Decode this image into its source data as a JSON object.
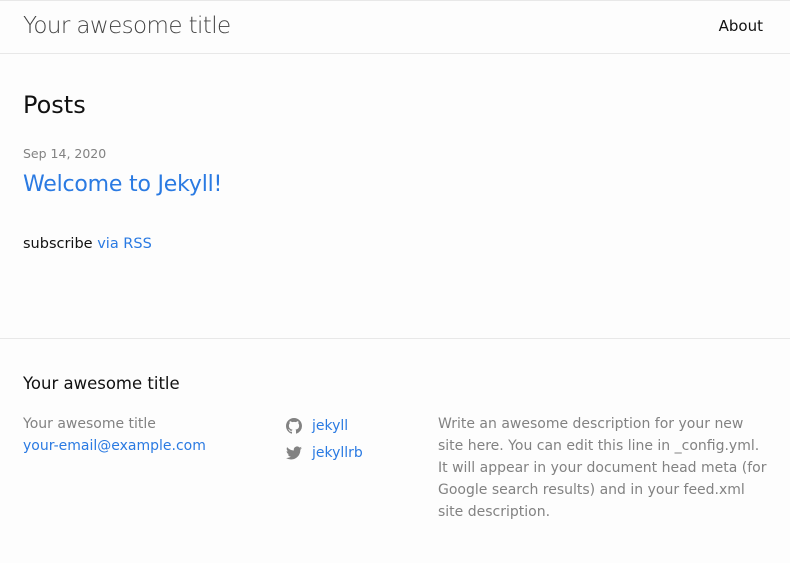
{
  "header": {
    "site_title": "Your awesome title",
    "nav": {
      "about_label": "About"
    }
  },
  "main": {
    "heading": "Posts",
    "posts": [
      {
        "date": "Sep 14, 2020",
        "title": "Welcome to Jekyll!"
      }
    ],
    "rss": {
      "prefix": "subscribe",
      "link_label": "via RSS"
    }
  },
  "footer": {
    "heading": "Your awesome title",
    "name": "Your awesome title",
    "email": "your-email@example.com",
    "social": [
      {
        "icon": "github-icon",
        "label": "jekyll"
      },
      {
        "icon": "twitter-icon",
        "label": "jekyllrb"
      }
    ],
    "description": "Write an awesome description for your new site here. You can edit this line in _config.yml. It will appear in your document head meta (for Google search results) and in your feed.xml site description."
  },
  "colors": {
    "background": "#fdfdfd",
    "text": "#111111",
    "link": "#2a7ae2",
    "muted": "#828282",
    "border": "#e8e8e8",
    "icon": "#828282"
  }
}
